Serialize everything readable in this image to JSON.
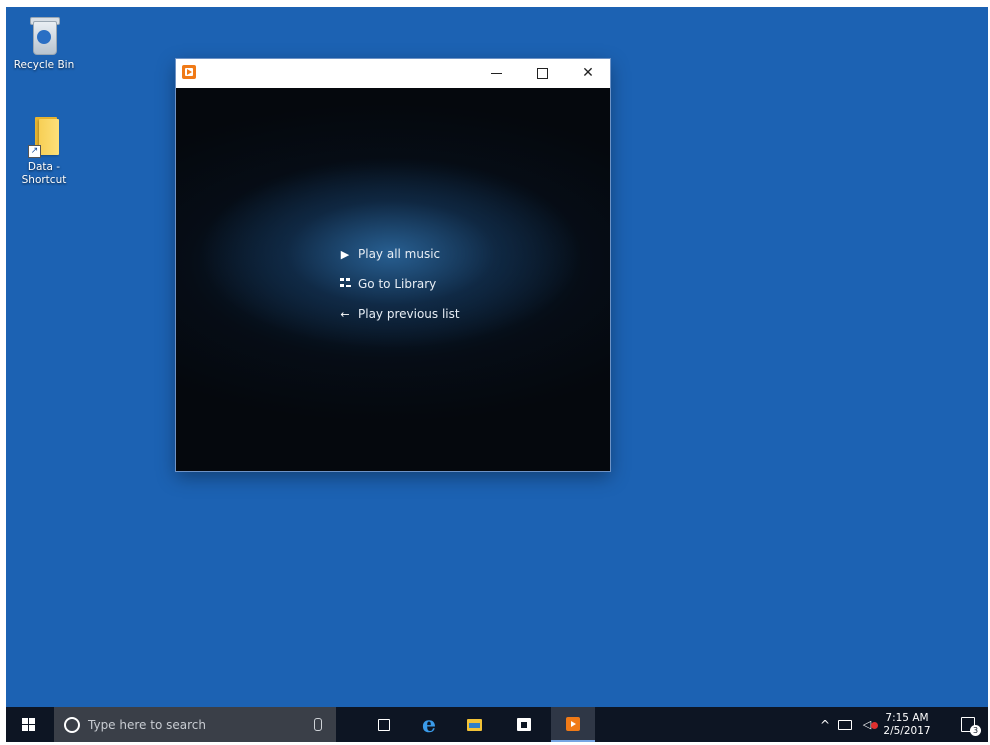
{
  "desktop": {
    "background_color": "#1c62b3",
    "icons": [
      {
        "label": "Recycle Bin",
        "icon": "recycle-bin-icon"
      },
      {
        "label": "Data -\nShortcut",
        "label_line1": "Data -",
        "label_line2": "Shortcut",
        "icon": "folder-shortcut-icon"
      }
    ]
  },
  "window": {
    "app_icon": "windows-media-player-icon",
    "controls": {
      "minimize": "minimize-icon",
      "maximize": "maximize-icon",
      "close": "close-icon",
      "close_glyph": "✕"
    },
    "menu": [
      {
        "label": "Play all music",
        "icon": "play-icon",
        "glyph": "▶"
      },
      {
        "label": "Go to Library",
        "icon": "library-icon",
        "glyph": ""
      },
      {
        "label": "Play previous list",
        "icon": "back-arrow-icon",
        "glyph": "←"
      }
    ]
  },
  "taskbar": {
    "search_placeholder": "Type here to search",
    "edge_glyph": "e",
    "tray_chevron": "^",
    "volume_glyph": "◁",
    "clock": {
      "time": "7:15 AM",
      "date": "2/5/2017"
    },
    "notifications_count": "3"
  }
}
